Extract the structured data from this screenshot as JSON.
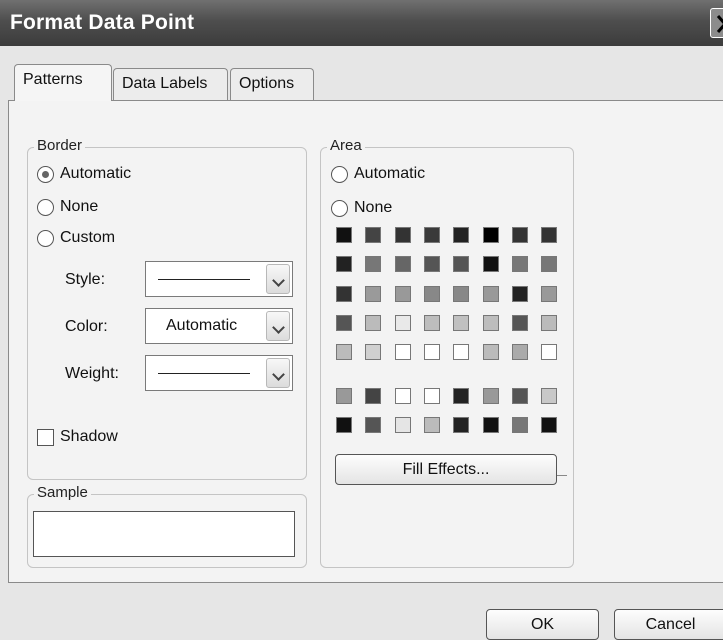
{
  "window": {
    "title": "Format Data Point"
  },
  "tabs": [
    {
      "label": "Patterns"
    },
    {
      "label": "Data Labels"
    },
    {
      "label": "Options"
    }
  ],
  "border": {
    "legend": "Border",
    "options": [
      "Automatic",
      "None",
      "Custom"
    ],
    "selected": "Automatic",
    "style_label": "Style:",
    "color_label": "Color:",
    "color_value": "Automatic",
    "weight_label": "Weight:",
    "shadow_label": "Shadow",
    "shadow_checked": false
  },
  "sample": {
    "legend": "Sample"
  },
  "area": {
    "legend": "Area",
    "options": [
      "Automatic",
      "None"
    ],
    "fill_effects_label": "Fill Effects...",
    "palette_top": [
      [
        "#111111",
        "#444444",
        "#333333",
        "#3a3a3a",
        "#222222",
        "#000000",
        "#333333",
        "#333333"
      ],
      [
        "#222222",
        "#777777",
        "#666666",
        "#555555",
        "#555555",
        "#111111",
        "#777777",
        "#777777"
      ],
      [
        "#333333",
        "#9a9a9a",
        "#999999",
        "#888888",
        "#888888",
        "#999999",
        "#222222",
        "#999999"
      ],
      [
        "#555555",
        "#bbbbbb",
        "#e9e9e9",
        "#bdbdbd",
        "#c0c0c0",
        "#bdbdbd",
        "#555555",
        "#bbbbbb"
      ],
      [
        "#bbbbbb",
        "#d0d0d0",
        "#ffffff",
        "#ffffff",
        "#ffffff",
        "#bbbbbb",
        "#aaaaaa",
        "#ffffff"
      ]
    ],
    "palette_bottom": [
      [
        "#999999",
        "#444444",
        "#ffffff",
        "#ffffff",
        "#222222",
        "#999999",
        "#555555",
        "#c8c8c8"
      ],
      [
        "#111111",
        "#555555",
        "#e5e5e5",
        "#bbbbbb",
        "#222222",
        "#111111",
        "#777777",
        "#111111"
      ]
    ]
  },
  "buttons": {
    "ok": "OK",
    "cancel": "Cancel"
  }
}
